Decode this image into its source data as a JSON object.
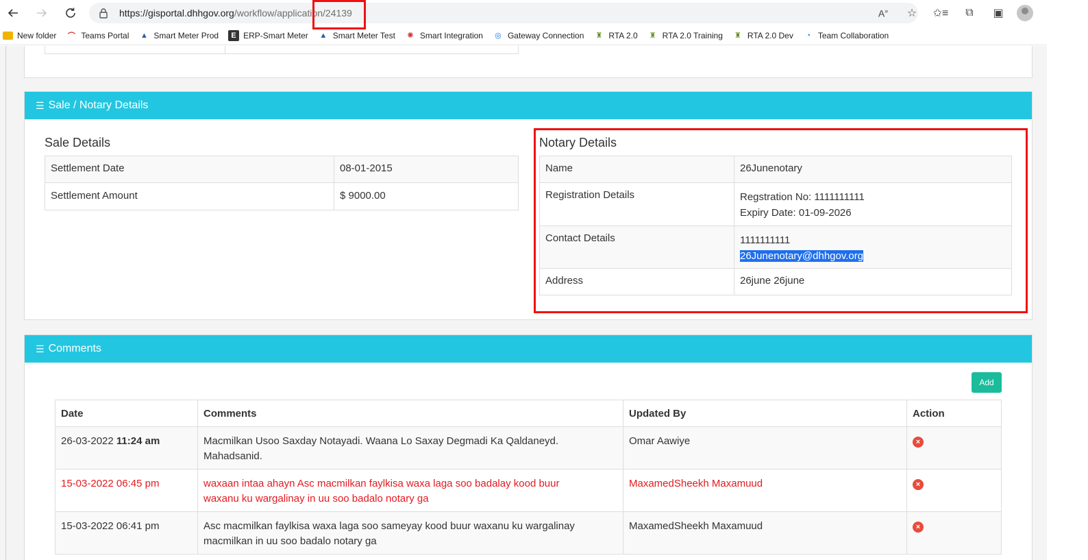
{
  "browser": {
    "url_host": "https://gisportal.dhhgov.org",
    "url_path": "/workflow/application/24139",
    "bookmarks": [
      {
        "label": "New folder",
        "icon": "folder-icon",
        "color": "#f0b400"
      },
      {
        "label": "Teams Portal",
        "icon": "teams-portal-icon",
        "color": "#d32f2f"
      },
      {
        "label": "Smart Meter Prod",
        "icon": "water-drop-icon",
        "color": "#1e5fa8"
      },
      {
        "label": "ERP-Smart Meter",
        "icon": "erp-icon",
        "color": "#333333"
      },
      {
        "label": "Smart Meter Test",
        "icon": "water-drop-icon",
        "color": "#1e5fa8"
      },
      {
        "label": "Smart Integration",
        "icon": "integration-icon",
        "color": "#d32f2f"
      },
      {
        "label": "Gateway Connection",
        "icon": "gateway-icon",
        "color": "#1a73e8"
      },
      {
        "label": "RTA 2.0",
        "icon": "rta-crest-icon",
        "color": "#6b8e23"
      },
      {
        "label": "RTA 2.0 Training",
        "icon": "rta-crest-icon",
        "color": "#6b8e23"
      },
      {
        "label": "RTA 2.0 Dev",
        "icon": "rta-crest-icon",
        "color": "#6b8e23"
      },
      {
        "label": "Team Collaboration",
        "icon": "team-collab-icon",
        "color": "#1a73e8"
      }
    ]
  },
  "sale_section": {
    "header": "Sale / Notary Details",
    "sale_title": "Sale Details",
    "sale_rows": [
      {
        "label": "Settlement Date",
        "value": "08-01-2015"
      },
      {
        "label": "Settlement Amount",
        "value": "$ 9000.00"
      }
    ],
    "notary_title": "Notary Details",
    "notary": {
      "name_label": "Name",
      "name": "26Junenotary",
      "reg_label": "Registration Details",
      "reg_no": "Regstration No: 1111111111",
      "expiry": "Expiry Date: 01-09-2026",
      "contact_label": "Contact Details",
      "phone": "1111111111",
      "email": "26Junenotary@dhhgov.org",
      "address_label": "Address",
      "address": "26june 26june"
    }
  },
  "comments_section": {
    "header": "Comments",
    "add_label": "Add",
    "columns": [
      "Date",
      "Comments",
      "Updated By",
      "Action"
    ],
    "rows": [
      {
        "date": "26-03-2022",
        "time": "11:24 am",
        "line1": "Macmilkan Usoo Saxday Notayadi. Waana Lo Saxay Degmadi Ka Qaldaneyd.",
        "line2": "Mahadsanid.",
        "by": "Omar Aawiye"
      },
      {
        "date": "15-03-2022",
        "time": "06:45 pm",
        "line1": "waxaan intaa ahayn Asc macmilkan faylkisa waxa laga soo badalay kood buur",
        "line2": "waxanu ku wargalinay in uu soo badalo notary ga",
        "by": "MaxamedSheekh Maxamuud"
      },
      {
        "date": "15-03-2022",
        "time": "06:41 pm",
        "line1": "Asc macmilkan faylkisa waxa laga soo sameyay kood buur waxanu ku wargalinay",
        "line2": "macmilkan in uu soo badalo notary ga",
        "by": "MaxamedSheekh Maxamuud"
      }
    ]
  }
}
